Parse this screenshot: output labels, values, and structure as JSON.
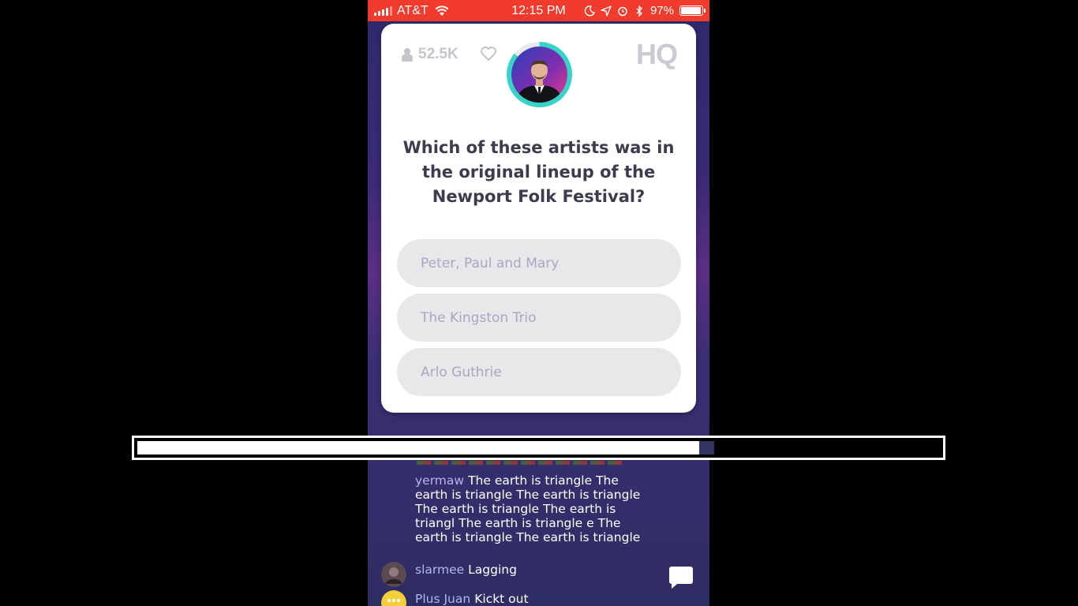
{
  "status_bar": {
    "carrier": "AT&T",
    "time": "12:15 PM",
    "battery": "97%",
    "battery_level": 0.97,
    "background_color": "#f13b2c"
  },
  "card": {
    "viewer_count": "52.5K",
    "logo": "HQ",
    "timer_ring_color": "#37d3c6",
    "question": "Which of these artists was in the original lineup of the Newport Folk Festival?",
    "answers": [
      {
        "label": "Peter, Paul and Mary"
      },
      {
        "label": "The Kingston Trio"
      },
      {
        "label": "Arlo Guthrie"
      }
    ]
  },
  "chat": {
    "messages": [
      {
        "user": "yermaw",
        "text": "The earth is triangle The earth is triangle The earth is triangle The earth is triangle The earth is triangl The earth is triangle e The earth is triangle The earth is triangle"
      },
      {
        "user": "slarmee",
        "text": "Lagging"
      },
      {
        "user": "Plus Juan",
        "text": "Kickt out"
      }
    ]
  },
  "overlay": {
    "progress": 0.7
  }
}
